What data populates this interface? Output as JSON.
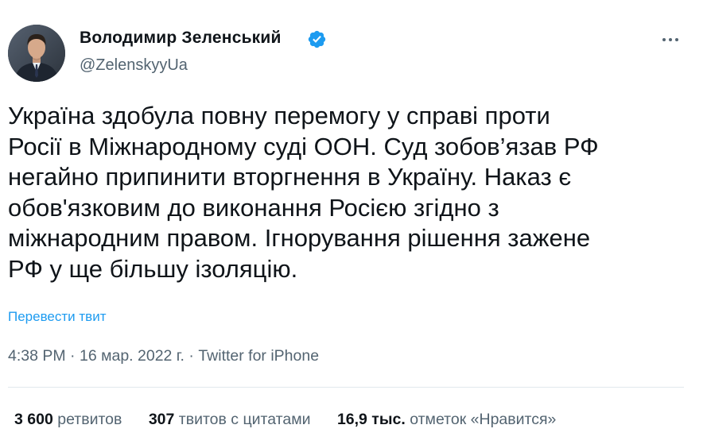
{
  "author": {
    "name": "Володимир Зеленський",
    "handle": "@ZelenskyyUa"
  },
  "tweet": {
    "lines": [
      "Україна здобула повну перемогу у справі проти",
      "Росії в Міжнародному суді ООН. Суд зобов’язав РФ",
      "негайно припинити вторгнення в Україну. Наказ є",
      "обов'язковим до виконання Росією згідно з",
      "міжнародним правом. Ігнорування рішення зажене",
      "РФ у ще більшу ізоляцію."
    ],
    "translate_label": "Перевести твит"
  },
  "meta": {
    "time": "4:38 PM",
    "separator": " · ",
    "date": "16 мар. 2022 г.",
    "source": "Twitter for iPhone"
  },
  "stats": {
    "retweets_count": "3 600",
    "retweets_label": "ретвитов",
    "quotes_count": "307",
    "quotes_label": "твитов с цитатами",
    "likes_count": "16,9 тыс.",
    "likes_label": "отметок «Нравится»"
  },
  "icons": {
    "verified": "verified-badge-icon",
    "more": "more-options-icon"
  },
  "colors": {
    "accent": "#1d9bf0",
    "text": "#0f1419",
    "secondary": "#536471",
    "divider": "#e1e8ed"
  }
}
